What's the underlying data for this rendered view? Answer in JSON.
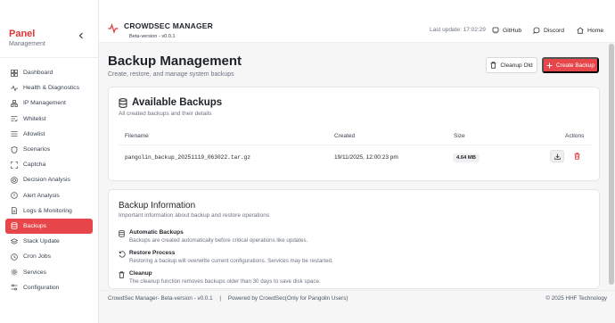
{
  "sidebar": {
    "brand": "Panel",
    "brand_sub": "Management",
    "collapse_icon": "chevron-left-icon",
    "items": [
      {
        "label": "Dashboard",
        "icon": "grid-icon"
      },
      {
        "label": "Health & Diagnostics",
        "icon": "activity-icon"
      },
      {
        "label": "IP Management",
        "icon": "network-icon"
      },
      {
        "label": "Whitelist",
        "icon": "list-check-icon"
      },
      {
        "label": "Allowlist",
        "icon": "list-icon"
      },
      {
        "label": "Scenarios",
        "icon": "shield-icon"
      },
      {
        "label": "Captcha",
        "icon": "captcha-icon"
      },
      {
        "label": "Decision Analysis",
        "icon": "target-icon"
      },
      {
        "label": "Alert Analysis",
        "icon": "alert-icon"
      },
      {
        "label": "Logs & Monitoring",
        "icon": "file-icon"
      },
      {
        "label": "Backups",
        "icon": "database-icon",
        "active": true
      },
      {
        "label": "Stack Update",
        "icon": "layers-icon"
      },
      {
        "label": "Cron Jobs",
        "icon": "clock-icon"
      },
      {
        "label": "Services",
        "icon": "gear-icon"
      },
      {
        "label": "Configuration",
        "icon": "sliders-icon"
      }
    ]
  },
  "topbar": {
    "title": "CROWDSEC MANAGER",
    "version": "Beta-version - v0.0.1",
    "last_update": "Last update: 17:02:29",
    "links": {
      "github": "GitHub",
      "discord": "Discord",
      "home": "Home"
    }
  },
  "page": {
    "title": "Backup Management",
    "subtitle": "Create, restore, and manage system backups",
    "cleanup_label": "Cleanup Old",
    "create_label": "Create Backup"
  },
  "backups_card": {
    "title": "Available Backups",
    "subtitle": "All created backups and their details",
    "columns": [
      "Filename",
      "Created",
      "Size",
      "Actions"
    ],
    "rows": [
      {
        "filename": "pangolin_backup_20251119_063022.tar.gz",
        "created": "19/11/2025, 12:00:23 pm",
        "size": "4.64 MB"
      }
    ]
  },
  "info_card": {
    "title": "Backup Information",
    "subtitle": "Important information about backup and restore operations",
    "items": [
      {
        "title": "Automatic Backups",
        "desc": "Backups are created automatically before critical operations like updates.",
        "icon": "database-icon"
      },
      {
        "title": "Restore Process",
        "desc": "Restoring a backup will overwrite current configurations. Services may be restarted.",
        "icon": "restore-icon"
      },
      {
        "title": "Cleanup",
        "desc": "The cleanup function removes backups older than 30 days to save disk space.",
        "icon": "trash-icon"
      }
    ]
  },
  "footer": {
    "left": "CrowdSec Manager- Beta-version - v0.0.1",
    "sep": "|",
    "powered": "Powered by CrowdSec(Only for Pangolin Users)",
    "right": "© 2025 HHF Technology"
  },
  "colors": {
    "accent": "#e7474b",
    "brand": "#e0353a"
  }
}
